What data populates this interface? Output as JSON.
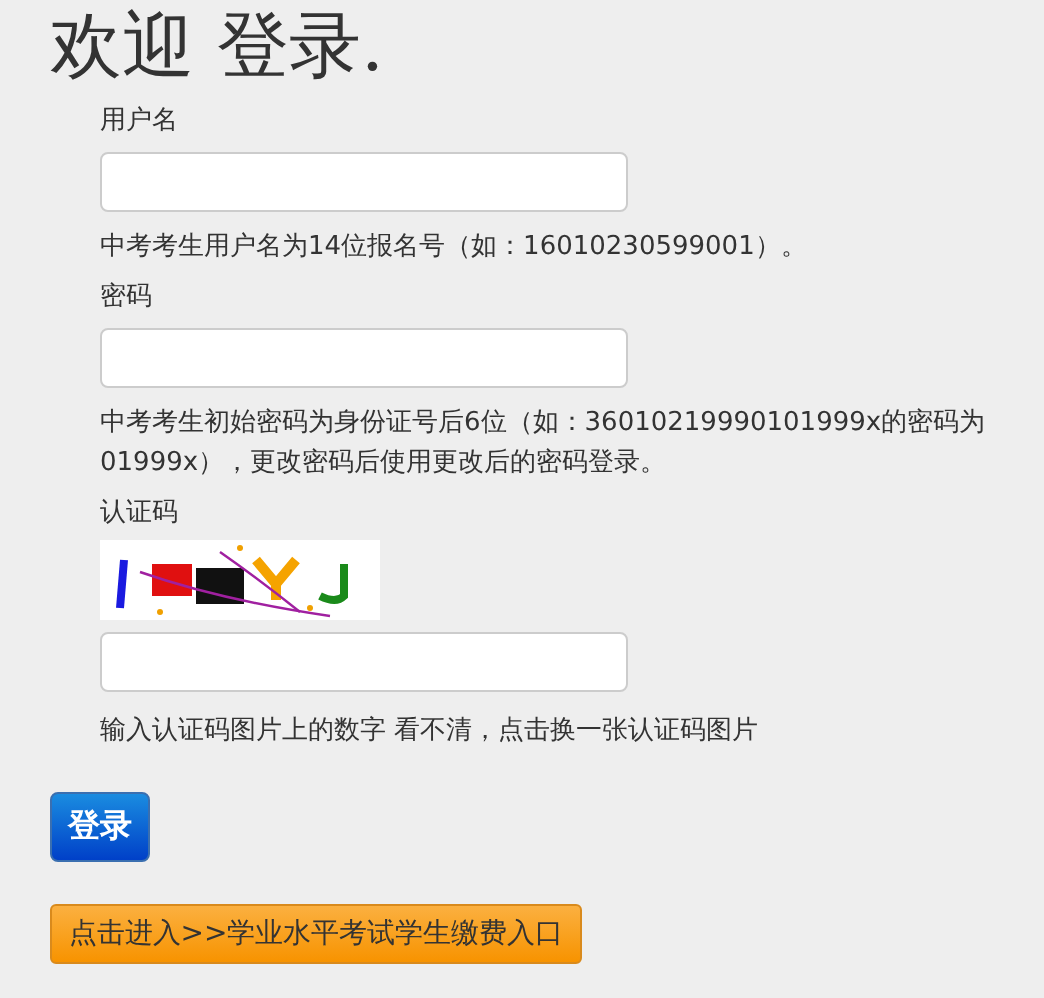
{
  "heading": "欢迎 登录.",
  "fields": [
    {
      "label": "用户名",
      "hint": "中考考生用户名为14位报名号（如：16010230599001）。"
    },
    {
      "label": "密码",
      "hint": "中考考生初始密码为身份证号后6位（如：36010219990101999x的密码为01999x），更改密码后使用更改后的密码登录。"
    }
  ],
  "captcha": {
    "label": "认证码",
    "hint": "输入认证码图片上的数字",
    "refresh_link": "看不清，点击换一张认证码图片"
  },
  "login_button": "登录",
  "fee_button": "点击进入>>学业水平考试学生缴费入口"
}
